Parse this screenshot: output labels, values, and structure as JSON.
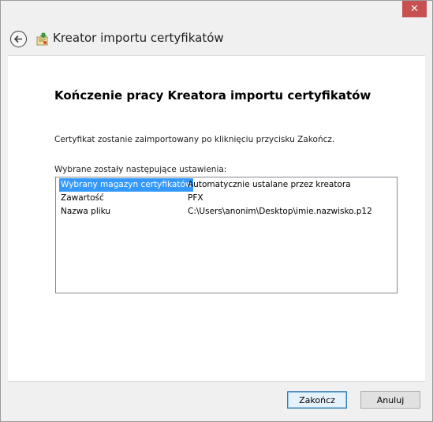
{
  "window": {
    "close_glyph": "✕"
  },
  "header": {
    "title": "Kreator importu certyfikatów"
  },
  "main": {
    "heading": "Kończenie pracy Kreatora importu certyfikatów",
    "description": "Certyfikat zostanie zaimportowany po kliknięciu przycisku Zakończ.",
    "list_label": "Wybrane zostały następujące ustawienia:",
    "settings": [
      {
        "key": "Wybrany magazyn certyfikatów",
        "value": "Automatycznie ustalane przez kreatora",
        "selected": true
      },
      {
        "key": "Zawartość",
        "value": "PFX",
        "selected": false
      },
      {
        "key": "Nazwa pliku",
        "value": "C:\\Users\\anonim\\Desktop\\imie.nazwisko.p12",
        "selected": false
      }
    ]
  },
  "footer": {
    "finish_label": "Zakończ",
    "cancel_label": "Anuluj"
  },
  "colors": {
    "selection": "#3399ff",
    "close_button": "#c75050"
  }
}
